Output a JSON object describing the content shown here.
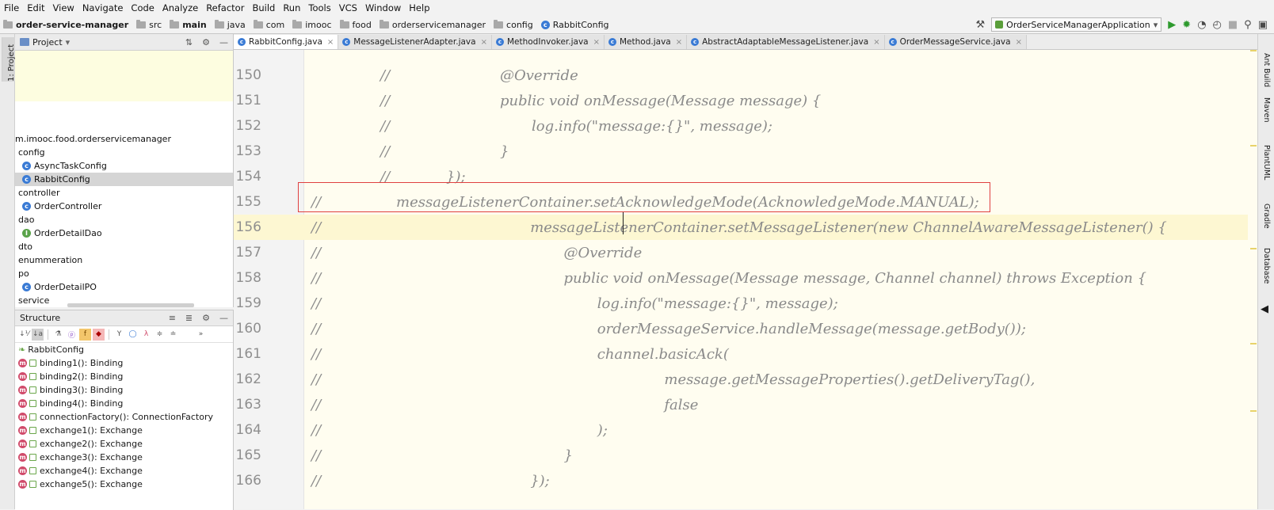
{
  "menu": [
    "File",
    "Edit",
    "View",
    "Navigate",
    "Code",
    "Analyze",
    "Refactor",
    "Build",
    "Run",
    "Tools",
    "VCS",
    "Window",
    "Help"
  ],
  "breadcrumb": [
    "order-service-manager",
    "src",
    "main",
    "java",
    "com",
    "imooc",
    "food",
    "orderservicemanager",
    "config",
    "RabbitConfig"
  ],
  "run_config": "OrderServiceManagerApplication",
  "project_panel": {
    "title": "Project",
    "tree": [
      {
        "label": "m.imooc.food.orderservicemanager",
        "icon": "none",
        "indent": 0
      },
      {
        "label": "config",
        "icon": "none",
        "indent": 1
      },
      {
        "label": "AsyncTaskConfig",
        "icon": "class",
        "indent": 2
      },
      {
        "label": "RabbitConfig",
        "icon": "class",
        "indent": 2,
        "selected": true
      },
      {
        "label": "controller",
        "icon": "none",
        "indent": 1
      },
      {
        "label": "OrderController",
        "icon": "class",
        "indent": 2
      },
      {
        "label": "dao",
        "icon": "none",
        "indent": 1
      },
      {
        "label": "OrderDetailDao",
        "icon": "interface",
        "indent": 2
      },
      {
        "label": "dto",
        "icon": "none",
        "indent": 1
      },
      {
        "label": "enummeration",
        "icon": "none",
        "indent": 1
      },
      {
        "label": "po",
        "icon": "none",
        "indent": 1
      },
      {
        "label": "OrderDetailPO",
        "icon": "class",
        "indent": 2
      },
      {
        "label": "service",
        "icon": "none",
        "indent": 1
      }
    ]
  },
  "structure_panel": {
    "title": "Structure",
    "root": "RabbitConfig",
    "members": [
      "binding1(): Binding",
      "binding2(): Binding",
      "binding3(): Binding",
      "binding4(): Binding",
      "connectionFactory(): ConnectionFactory",
      "exchange1(): Exchange",
      "exchange2(): Exchange",
      "exchange3(): Exchange",
      "exchange4(): Exchange",
      "exchange5(): Exchange"
    ]
  },
  "tabs": [
    {
      "label": "RabbitConfig.java",
      "active": true
    },
    {
      "label": "MessageListenerAdapter.java"
    },
    {
      "label": "MethodInvoker.java"
    },
    {
      "label": "Method.java"
    },
    {
      "label": "AbstractAdaptableMessageListener.java"
    },
    {
      "label": "OrderMessageService.java"
    }
  ],
  "code_lines": [
    {
      "n": "150",
      "indent": 2,
      "text": "@Override",
      "cmt_pos": "far"
    },
    {
      "n": "151",
      "indent": 2,
      "text": "public void onMessage(Message message) {",
      "cmt_pos": "far"
    },
    {
      "n": "152",
      "indent": 3,
      "text": "log.info(\"message:{}\", message);",
      "cmt_pos": "far"
    },
    {
      "n": "153",
      "indent": 2,
      "text": "}",
      "cmt_pos": "far"
    },
    {
      "n": "154",
      "indent": 1,
      "text": "});",
      "cmt_pos": "far"
    },
    {
      "n": "155",
      "indent": 0,
      "text": "messageListenerContainer.setAcknowledgeMode(AcknowledgeMode.MANUAL);",
      "cmt_pos": "near"
    },
    {
      "n": "156",
      "indent": 4,
      "text": "messageListenerContainer.setMessageListener(new ChannelAwareMessageListener() {",
      "cmt_pos": "near",
      "current": true
    },
    {
      "n": "157",
      "indent": 5,
      "text": "@Override",
      "cmt_pos": "near"
    },
    {
      "n": "158",
      "indent": 5,
      "text": "public void onMessage(Message message, Channel channel) throws Exception {",
      "cmt_pos": "near"
    },
    {
      "n": "159",
      "indent": 6,
      "text": "log.info(\"message:{}\", message);",
      "cmt_pos": "near"
    },
    {
      "n": "160",
      "indent": 6,
      "text": "orderMessageService.handleMessage(message.getBody());",
      "cmt_pos": "near"
    },
    {
      "n": "161",
      "indent": 6,
      "text": "channel.basicAck(",
      "cmt_pos": "near"
    },
    {
      "n": "162",
      "indent": 8,
      "text": "message.getMessageProperties().getDeliveryTag(),",
      "cmt_pos": "near"
    },
    {
      "n": "163",
      "indent": 8,
      "text": "false",
      "cmt_pos": "near"
    },
    {
      "n": "164",
      "indent": 6,
      "text": ");",
      "cmt_pos": "near"
    },
    {
      "n": "165",
      "indent": 5,
      "text": "}",
      "cmt_pos": "near"
    },
    {
      "n": "166",
      "indent": 4,
      "text": "});",
      "cmt_pos": "near"
    }
  ],
  "comment_marker": "//",
  "side_tools": [
    "1: Project",
    "Ant Build",
    "Maven",
    "PlantUML",
    "Gradle",
    "Database"
  ]
}
